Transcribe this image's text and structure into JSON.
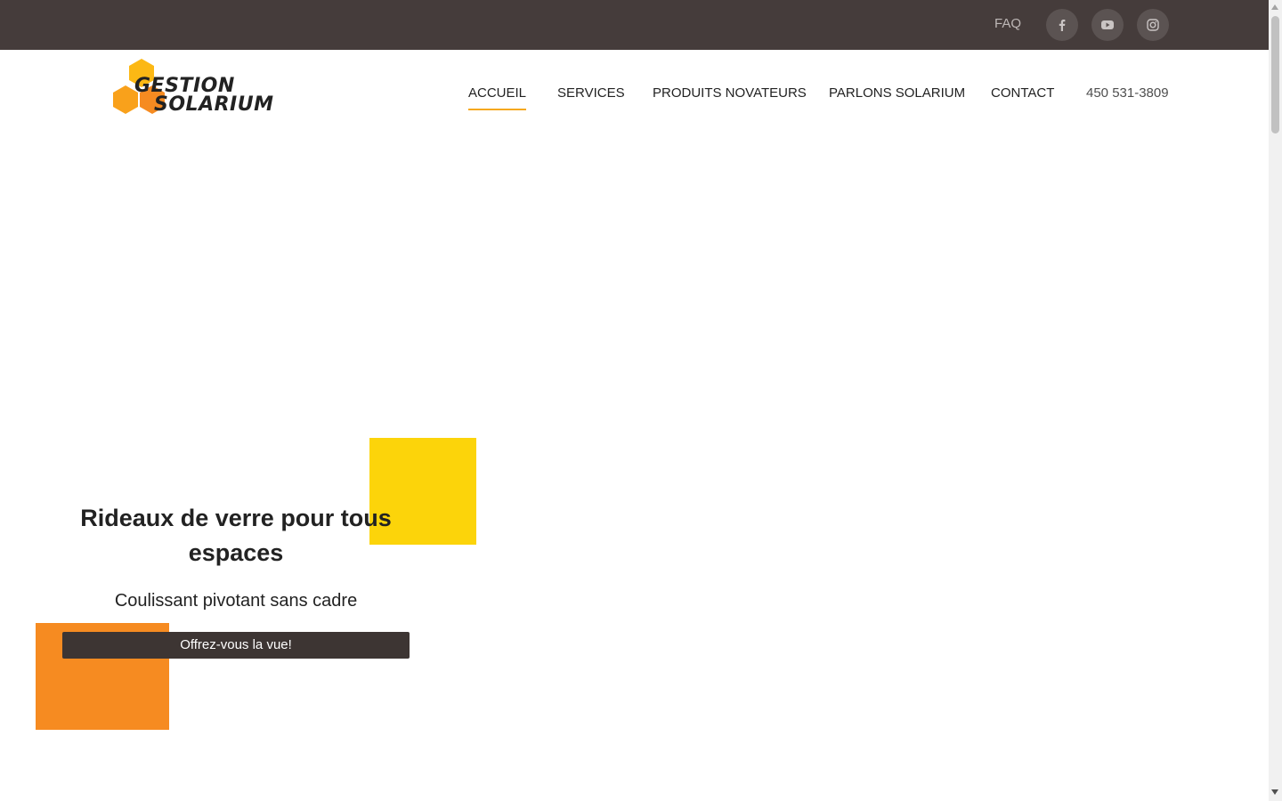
{
  "topbar": {
    "faq_label": "FAQ",
    "social": [
      {
        "icon": "facebook-icon"
      },
      {
        "icon": "youtube-icon"
      },
      {
        "icon": "instagram-icon"
      }
    ]
  },
  "header": {
    "logo": {
      "line1": "GESTION",
      "line2": "SOLARIUM"
    },
    "nav": [
      {
        "label": "ACCUEIL",
        "active": true
      },
      {
        "label": "SERVICES"
      },
      {
        "label": "PRODUITS NOVATEURS"
      },
      {
        "label": "PARLONS SOLARIUM"
      },
      {
        "label": "CONTACT"
      }
    ],
    "phone": "450 531-3809"
  },
  "hero": {
    "title": "Rideaux de verre pour tous espaces",
    "subtitle": "Coulissant pivotant sans cadre",
    "cta_label": "Offrez-vous la vue!"
  },
  "colors": {
    "topbar": "#453c3b",
    "accent_yellow": "#fcd40a",
    "accent_orange": "#f68b21",
    "button": "#3d3533"
  }
}
